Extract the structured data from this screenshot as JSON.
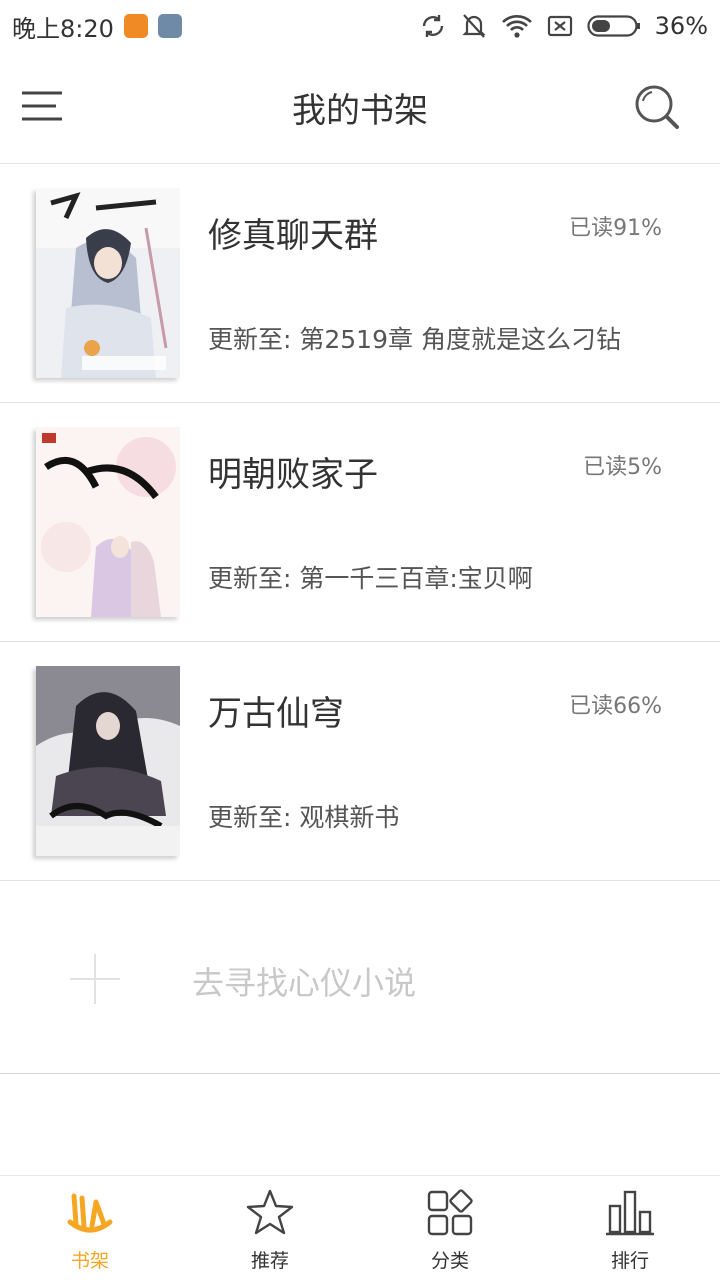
{
  "status_bar": {
    "time": "晚上8:20",
    "battery": "36%"
  },
  "header": {
    "title": "我的书架"
  },
  "books": [
    {
      "title": "修真聊天群",
      "progress": "已读91%",
      "update_prefix": "更新至: ",
      "update_chapter": "第2519章 角度就是这么刁钻"
    },
    {
      "title": "明朝败家子",
      "progress": "已读5%",
      "update_prefix": "更新至: ",
      "update_chapter": "第一千三百章:宝贝啊"
    },
    {
      "title": "万古仙穹",
      "progress": "已读66%",
      "update_prefix": "更新至: ",
      "update_chapter": "观棋新书"
    }
  ],
  "add_more": {
    "label": "去寻找心仪小说"
  },
  "bottom_nav": [
    {
      "label": "书架",
      "icon": "bookshelf-icon",
      "active": true
    },
    {
      "label": "推荐",
      "icon": "star-icon",
      "active": false
    },
    {
      "label": "分类",
      "icon": "category-icon",
      "active": false
    },
    {
      "label": "排行",
      "icon": "ranking-icon",
      "active": false
    }
  ],
  "colors": {
    "accent": "#f5a623",
    "text": "#333333",
    "muted": "#777777",
    "divider": "#e0e0e0"
  }
}
